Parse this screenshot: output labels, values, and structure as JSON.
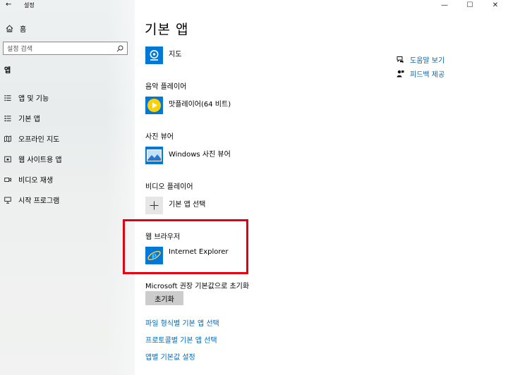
{
  "window": {
    "back_glyph": "←",
    "title": "설정",
    "controls": [
      "—",
      "☐",
      "✕"
    ]
  },
  "sidebar": {
    "home_label": "홈",
    "search_placeholder": "설정 검색",
    "section_title": "앱",
    "items": [
      {
        "label": "앱 및 기능",
        "icon": "apps-features-icon"
      },
      {
        "label": "기본 앱",
        "icon": "default-apps-icon"
      },
      {
        "label": "오프라인 지도",
        "icon": "offline-maps-icon"
      },
      {
        "label": "웹 사이트용 앱",
        "icon": "apps-for-websites-icon"
      },
      {
        "label": "비디오 재생",
        "icon": "video-playback-icon"
      },
      {
        "label": "시작 프로그램",
        "icon": "startup-icon"
      }
    ]
  },
  "main": {
    "title": "기본 앱",
    "maps_app": "지도",
    "music": {
      "label": "음악 플레이어",
      "app": "맛플레이어(64 비트)"
    },
    "photo": {
      "label": "사진 뷰어",
      "app": "Windows 사진 뷰어"
    },
    "video": {
      "label": "비디오 플레이어",
      "app": "기본 앱 선택"
    },
    "browser": {
      "label": "웹 브라우저",
      "app": "Internet Explorer"
    },
    "reset": {
      "label": "Microsoft 권장 기본값으로 초기화",
      "button": "초기화"
    },
    "links": [
      "파일 형식별 기본 앱 선택",
      "프로토콜별 기본 앱 선택",
      "앱별 기본값 설정"
    ]
  },
  "help": {
    "get_help": "도움말 보기",
    "feedback": "피드백 제공"
  },
  "colors": {
    "accent": "#0067b8",
    "highlight": "#e00012",
    "tile_blue": "#0078d7"
  }
}
